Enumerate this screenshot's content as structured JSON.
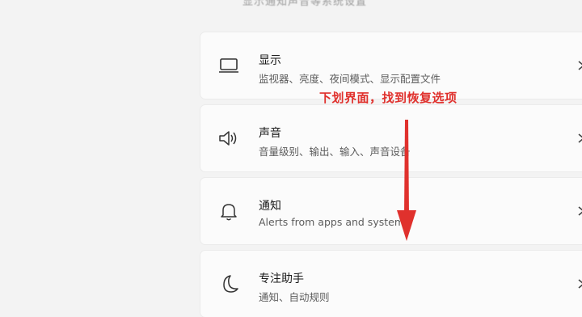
{
  "header": {
    "cut_text": "显示通知声音等系统设置"
  },
  "settings_items": [
    {
      "icon": "monitor-icon",
      "title": "显示",
      "subtitle": "监视器、亮度、夜间模式、显示配置文件"
    },
    {
      "icon": "speaker-icon",
      "title": "声音",
      "subtitle": "音量级别、输出、输入、声音设备"
    },
    {
      "icon": "bell-icon",
      "title": "通知",
      "subtitle": "Alerts from apps and system"
    },
    {
      "icon": "moon-icon",
      "title": "专注助手",
      "subtitle": "通知、自动规则"
    }
  ],
  "annotation": {
    "text": "下划界面，找到恢复选项",
    "color": "#e0312d"
  },
  "colors": {
    "background": "#f3f3f3",
    "card": "#fbfbfb",
    "title_text": "#1a1a1a",
    "subtitle_text": "#5c5c5c"
  }
}
